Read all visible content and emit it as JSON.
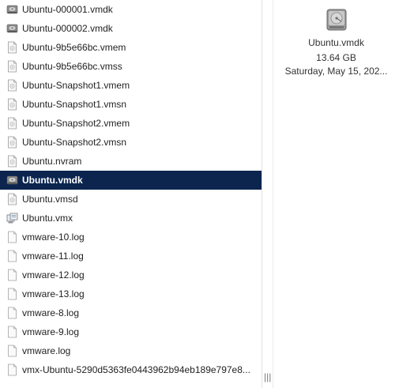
{
  "file_list": {
    "items": [
      {
        "name": "Ubuntu-000001.vmdk",
        "icon": "disk-icon",
        "selected": false
      },
      {
        "name": "Ubuntu-000002.vmdk",
        "icon": "disk-icon",
        "selected": false
      },
      {
        "name": "Ubuntu-9b5e66bc.vmem",
        "icon": "document-icon",
        "selected": false
      },
      {
        "name": "Ubuntu-9b5e66bc.vmss",
        "icon": "document-icon",
        "selected": false
      },
      {
        "name": "Ubuntu-Snapshot1.vmem",
        "icon": "document-icon",
        "selected": false
      },
      {
        "name": "Ubuntu-Snapshot1.vmsn",
        "icon": "document-icon",
        "selected": false
      },
      {
        "name": "Ubuntu-Snapshot2.vmem",
        "icon": "document-icon",
        "selected": false
      },
      {
        "name": "Ubuntu-Snapshot2.vmsn",
        "icon": "document-icon",
        "selected": false
      },
      {
        "name": "Ubuntu.nvram",
        "icon": "document-icon",
        "selected": false
      },
      {
        "name": "Ubuntu.vmdk",
        "icon": "disk-icon",
        "selected": true
      },
      {
        "name": "Ubuntu.vmsd",
        "icon": "document-icon",
        "selected": false
      },
      {
        "name": "Ubuntu.vmx",
        "icon": "vm-config-icon",
        "selected": false
      },
      {
        "name": "vmware-10.log",
        "icon": "text-file-icon",
        "selected": false
      },
      {
        "name": "vmware-11.log",
        "icon": "text-file-icon",
        "selected": false
      },
      {
        "name": "vmware-12.log",
        "icon": "text-file-icon",
        "selected": false
      },
      {
        "name": "vmware-13.log",
        "icon": "text-file-icon",
        "selected": false
      },
      {
        "name": "vmware-8.log",
        "icon": "text-file-icon",
        "selected": false
      },
      {
        "name": "vmware-9.log",
        "icon": "text-file-icon",
        "selected": false
      },
      {
        "name": "vmware.log",
        "icon": "text-file-icon",
        "selected": false
      },
      {
        "name": "vmx-Ubuntu-5290d5363fe0443962b94eb189e797e8...",
        "icon": "text-file-icon",
        "selected": false
      }
    ]
  },
  "preview": {
    "icon": "disk-icon",
    "filename": "Ubuntu.vmdk",
    "size": "13.64 GB",
    "date": "Saturday, May 15, 202..."
  },
  "colors": {
    "selection": "#0b254f",
    "selection_text": "#ffffff"
  }
}
